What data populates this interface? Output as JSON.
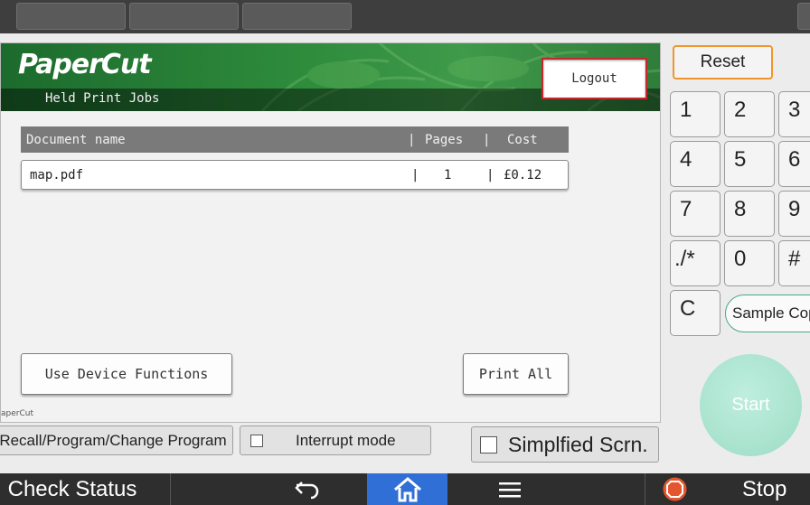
{
  "topbar": {
    "slots": 4
  },
  "papercut": {
    "logo": "PaperCut",
    "subtitle": "Held Print Jobs",
    "logout_label": "Logout",
    "table": {
      "headers": {
        "name": "Document name",
        "pages": "Pages",
        "cost": "Cost"
      },
      "separator": "|",
      "rows": [
        {
          "name": "map.pdf",
          "pages": "1",
          "cost": "£0.12"
        }
      ]
    },
    "use_device_label": "Use Device Functions",
    "print_all_label": "Print All",
    "footer_tag": "aperCut"
  },
  "panel_buttons": {
    "recall_label": "Recall/Program/Change Program",
    "interrupt_label": "Interrupt mode",
    "simplified_label": "Simplfied Scrn."
  },
  "keypad": {
    "reset_label": "Reset",
    "keys": [
      "1",
      "2",
      "3",
      "4",
      "5",
      "6",
      "7",
      "8",
      "9",
      "./*",
      "0",
      "#",
      "C"
    ],
    "sample_copy_label": "Sample Copy",
    "start_label": "Start"
  },
  "bottombar": {
    "check_status_label": "Check Status",
    "stop_label": "Stop",
    "home_color": "#2f6fd6",
    "stop_icon_color": "#e4572e"
  }
}
